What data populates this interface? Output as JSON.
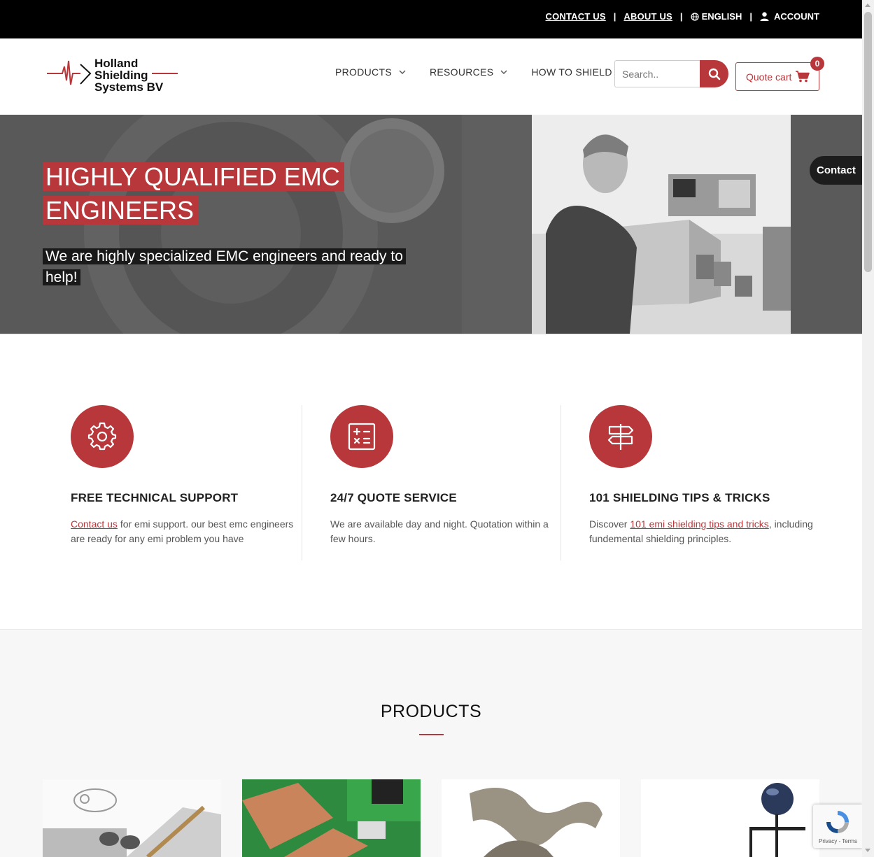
{
  "topbar": {
    "contact_us": "CONTACT US",
    "about_us": "ABOUT US",
    "language": "ENGLISH",
    "account": "ACCOUNT",
    "separator": "|"
  },
  "header": {
    "logo_lines": [
      "Holland",
      "Shielding",
      "Systems BV"
    ],
    "nav": [
      "PRODUCTS",
      "RESOURCES",
      "HOW TO SHIELD"
    ],
    "search_placeholder": "Search..",
    "quote_cart_label": "Quote cart",
    "quote_cart_count": "0"
  },
  "hero": {
    "title": "HIGHLY QUALIFIED EMC ENGINEERS",
    "subtitle": "We are highly specialized EMC engineers and ready to help!"
  },
  "contact_tab": "Contact",
  "features": [
    {
      "icon": "gear-icon",
      "title": "FREE TECHNICAL SUPPORT",
      "link": "Contact us",
      "text_after": " for emi support. our best emc engineers are ready for any emi problem you have"
    },
    {
      "icon": "calculator-icon",
      "title": "24/7 QUOTE SERVICE",
      "text": "We are available day and night. Quotation within a few hours."
    },
    {
      "icon": "signpost-icon",
      "title": "101 SHIELDING TIPS & TRICKS",
      "text_before": "Discover ",
      "link": "101 emi shielding tips and tricks",
      "text_after": ", including fundemental shielding principles."
    }
  ],
  "products": {
    "heading": "PRODUCTS"
  },
  "recaptcha": "Privacy - Terms",
  "colors": {
    "accent": "#b7373a",
    "topbar": "#000000"
  }
}
